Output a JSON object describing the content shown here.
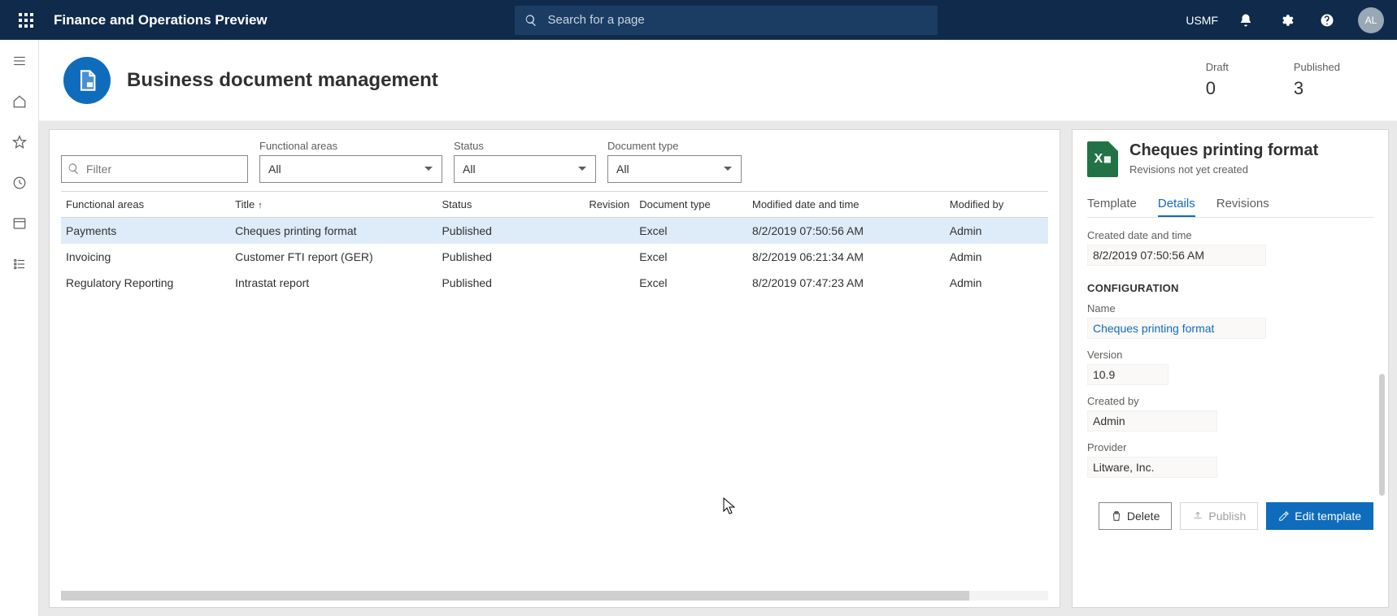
{
  "topbar": {
    "app_title": "Finance and Operations Preview",
    "search_placeholder": "Search for a page",
    "company": "USMF",
    "avatar_initials": "AL"
  },
  "page": {
    "title": "Business document management",
    "stats": {
      "draft_label": "Draft",
      "draft_value": "0",
      "published_label": "Published",
      "published_value": "3"
    }
  },
  "filters": {
    "filter_placeholder": "Filter",
    "functional_areas_label": "Functional areas",
    "functional_areas_value": "All",
    "status_label": "Status",
    "status_value": "All",
    "doctype_label": "Document type",
    "doctype_value": "All"
  },
  "table": {
    "headers": {
      "functional_areas": "Functional areas",
      "title": "Title",
      "status": "Status",
      "revision": "Revision",
      "document_type": "Document type",
      "modified": "Modified date and time",
      "modified_by": "Modified by"
    },
    "rows": [
      {
        "functional_areas": "Payments",
        "title": "Cheques printing format",
        "status": "Published",
        "revision": "",
        "document_type": "Excel",
        "modified": "8/2/2019 07:50:56 AM",
        "modified_by": "Admin"
      },
      {
        "functional_areas": "Invoicing",
        "title": "Customer FTI report (GER)",
        "status": "Published",
        "revision": "",
        "document_type": "Excel",
        "modified": "8/2/2019 06:21:34 AM",
        "modified_by": "Admin"
      },
      {
        "functional_areas": "Regulatory Reporting",
        "title": "Intrastat report",
        "status": "Published",
        "revision": "",
        "document_type": "Excel",
        "modified": "8/2/2019 07:47:23 AM",
        "modified_by": "Admin"
      }
    ]
  },
  "detail": {
    "title": "Cheques printing format",
    "subtitle": "Revisions not yet created",
    "tabs": {
      "template": "Template",
      "details": "Details",
      "revisions": "Revisions"
    },
    "created_label": "Created date and time",
    "created_value": "8/2/2019 07:50:56 AM",
    "configuration_label": "CONFIGURATION",
    "name_label": "Name",
    "name_value": "Cheques printing format",
    "version_label": "Version",
    "version_value": "10.9",
    "createdby_label": "Created by",
    "createdby_value": "Admin",
    "provider_label": "Provider",
    "provider_value": "Litware, Inc.",
    "actions": {
      "delete": "Delete",
      "publish": "Publish",
      "edit": "Edit template"
    }
  }
}
